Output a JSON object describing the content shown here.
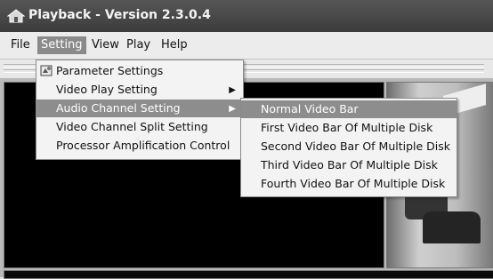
{
  "window": {
    "title": "Playback - Version 2.3.0.4"
  },
  "menu": [
    {
      "id": "file",
      "label": "File"
    },
    {
      "id": "setting",
      "label": "Setting"
    },
    {
      "id": "view",
      "label": "View"
    },
    {
      "id": "play",
      "label": "Play"
    },
    {
      "id": "help",
      "label": "Help"
    }
  ],
  "setting_menu": [
    {
      "label": "Parameter Settings",
      "icon": "parameter-settings-icon"
    },
    {
      "label": "Video Play Setting",
      "submenu": true
    },
    {
      "label": "Audio Channel Setting",
      "submenu": true,
      "selected": true
    },
    {
      "label": "Video Channel Split Setting"
    },
    {
      "label": "Processor Amplification Control"
    }
  ],
  "audio_submenu": [
    {
      "label": "Normal Video Bar",
      "selected": true
    },
    {
      "label": "First Video Bar Of Multiple Disk"
    },
    {
      "label": "Second Video Bar Of Multiple Disk"
    },
    {
      "label": "Third Video Bar Of Multiple Disk"
    },
    {
      "label": "Fourth Video Bar Of Multiple Disk"
    }
  ],
  "colors": {
    "title_bar": "#3f3f3f",
    "highlight": "#8d8d8d",
    "menu_bg": "#f3f3f3"
  }
}
